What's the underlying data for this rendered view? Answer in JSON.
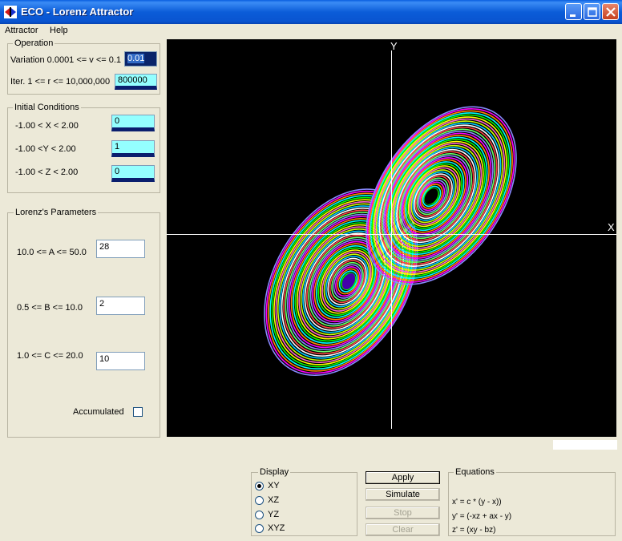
{
  "window": {
    "title": "ECO - Lorenz Attractor"
  },
  "menu": [
    "Attractor",
    "Help"
  ],
  "operation": {
    "legend": "Operation",
    "variation_label": "Variation  0.0001 <= v <= 0.1",
    "variation_value": "0.01",
    "iter_label": "Iter. 1 <= r <= 10,000,000",
    "iter_value": "800000"
  },
  "initial_conditions": {
    "legend": "Initial Conditions",
    "x_label": "-1.00 < X < 2.00",
    "x_value": "0",
    "y_label": "-1.00 <Y < 2.00",
    "y_value": "1",
    "z_label": "-1.00 < Z < 2.00",
    "z_value": "0"
  },
  "parameters": {
    "legend": "Lorenz's Parameters",
    "a_label": "10.0 <= A <= 50.0",
    "a_value": "28",
    "b_label": "0.5 <= B <= 10.0",
    "b_value": "2",
    "c_label": "1.0 <= C <= 20.0",
    "c_value": "10",
    "accumulated_label": "Accumulated",
    "accumulated_checked": false
  },
  "plot": {
    "x_axis_label": "X",
    "y_axis_label": "Y",
    "background": "#000000",
    "axis_color": "#FFFFFF"
  },
  "display": {
    "legend": "Display",
    "options": [
      "XY",
      "XZ",
      "YZ",
      "XYZ"
    ],
    "selected": "XY"
  },
  "buttons": {
    "apply": "Apply",
    "simulate": "Simulate",
    "stop": "Stop",
    "clear": "Clear"
  },
  "equations": {
    "legend": "Equations",
    "x": "x' = c * (y - x))",
    "y": "y' = (-xz + ax - y)",
    "z": "z' = (xy - bz)"
  },
  "colors": {
    "titlebar": "#0A5FE0",
    "field_cyan": "#94FFFF",
    "panel": "#ECE9D8"
  }
}
